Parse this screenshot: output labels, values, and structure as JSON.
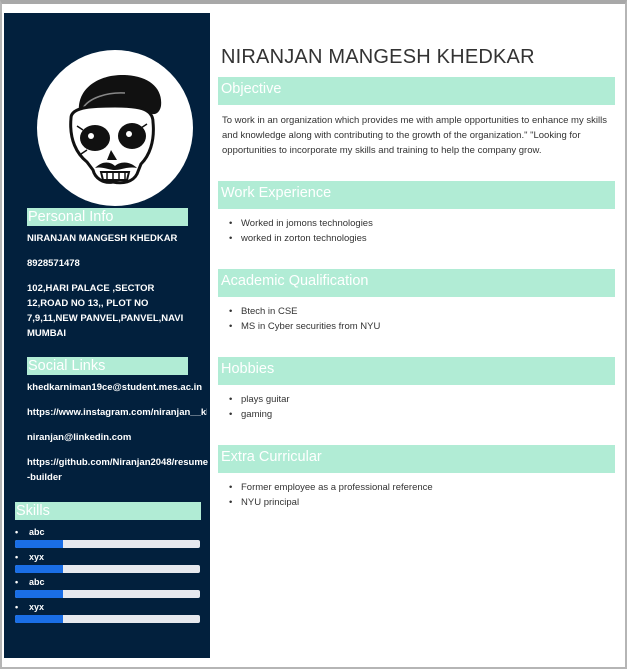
{
  "name": "NIRANJAN MANGESH KHEDKAR",
  "sidebar": {
    "avatar_label": "skull-avatar",
    "personal": {
      "heading": "Personal Info",
      "name": "NIRANJAN MANGESH KHEDKAR",
      "phone": "8928571478",
      "address": "102,HARI PALACE ,SECTOR 12,ROAD NO 13,, PLOT NO 7,9,11,NEW PANVEL,PANVEL,NAVI MUMBAI"
    },
    "social": {
      "heading": "Social Links",
      "email": "khedkarniman19ce@student.mes.ac.in",
      "instagram": "https://www.instagram.com/niranjan__khe",
      "linkedin": "niranjan@linkedin.com",
      "github": "https://github.com/Niranjan2048/resume-builder"
    },
    "skills": {
      "heading": "Skills",
      "items": [
        {
          "name": "abc",
          "level": 0.26
        },
        {
          "name": "xyx",
          "level": 0.26
        },
        {
          "name": "abc",
          "level": 0.26
        },
        {
          "name": "xyx",
          "level": 0.26
        }
      ]
    }
  },
  "sections": {
    "objective": {
      "heading": "Objective",
      "text": "To work in an organization which provides me with ample opportunities to enhance my skills and knowledge along with contributing to the growth of the organization.\" \"Looking for opportunities to incorporate my skills and training to help the company grow."
    },
    "work": {
      "heading": "Work Experience",
      "items": [
        "Worked in jomons technologies",
        "worked in zorton technologies"
      ]
    },
    "academic": {
      "heading": "Academic Qualification",
      "items": [
        "Btech in CSE",
        "MS in Cyber securities from NYU"
      ]
    },
    "hobbies": {
      "heading": "Hobbies",
      "items": [
        "plays guitar",
        "gaming"
      ]
    },
    "extra": {
      "heading": "Extra Curricular",
      "items": [
        "Former employee as a professional reference",
        "NYU principal"
      ]
    }
  },
  "bullet": "•",
  "colors": {
    "sidebar_bg": "#02203d",
    "heading_bg": "#b1ecd5",
    "skill_bar": "#1a6ee6",
    "skill_track": "#e7e9ee"
  }
}
